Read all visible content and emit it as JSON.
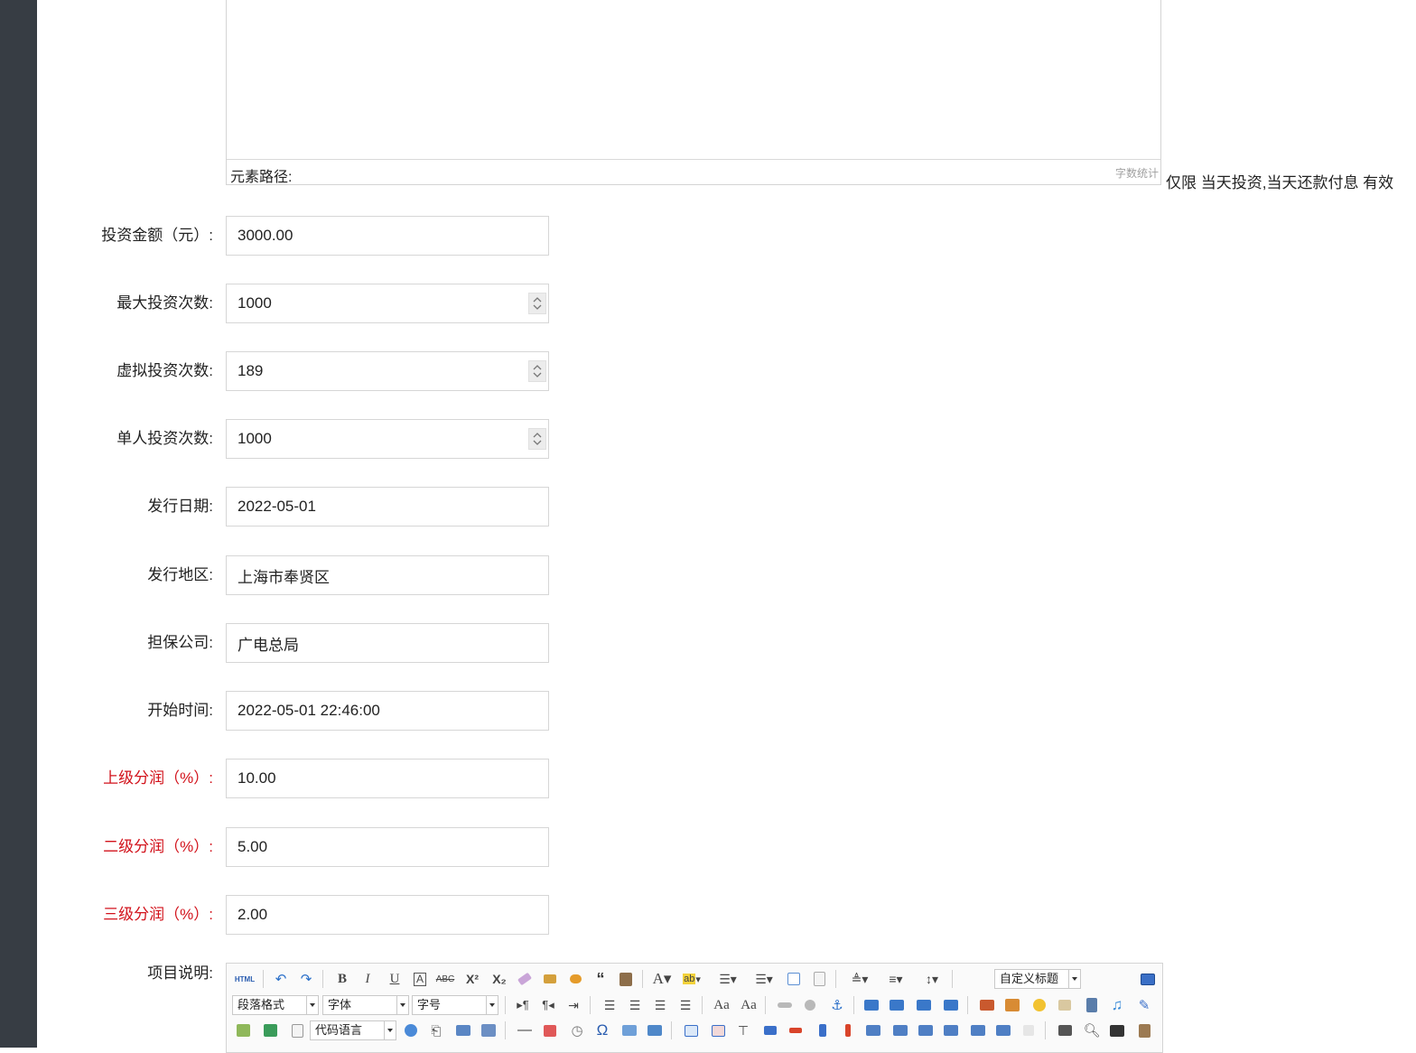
{
  "editor_top": {
    "element_path_label": "元素路径:",
    "word_count_label": "字数统计"
  },
  "note_text": "仅限 当天投资,当天还款付息 有效",
  "fields": [
    {
      "label": "投资金额（元）:",
      "value": "3000.00",
      "type": "text",
      "required": false
    },
    {
      "label": "最大投资次数:",
      "value": "1000",
      "type": "number",
      "required": false
    },
    {
      "label": "虚拟投资次数:",
      "value": "189",
      "type": "number",
      "required": false
    },
    {
      "label": "单人投资次数:",
      "value": "1000",
      "type": "number",
      "required": false
    },
    {
      "label": "发行日期:",
      "value": "2022-05-01",
      "type": "text",
      "required": false
    },
    {
      "label": "发行地区:",
      "value": "上海市奉贤区",
      "type": "text",
      "required": false
    },
    {
      "label": "担保公司:",
      "value": "广电总局",
      "type": "text",
      "required": false
    },
    {
      "label": "开始时间:",
      "value": "2022-05-01 22:46:00",
      "type": "text",
      "required": false
    },
    {
      "label": "上级分润（%）:",
      "value": "10.00",
      "type": "text",
      "required": true
    },
    {
      "label": "二级分润（%）:",
      "value": "5.00",
      "type": "text",
      "required": true
    },
    {
      "label": "三级分润（%）:",
      "value": "2.00",
      "type": "text",
      "required": true
    }
  ],
  "project_description_label": "项目说明:",
  "editor_bottom": {
    "html_label": "HTML",
    "custom_heading": "自定义标题",
    "paragraph_format": "段落格式",
    "font_family": "字体",
    "font_size": "字号",
    "code_language": "代码语言"
  },
  "colors": {
    "sidebar": "#373d44",
    "required_label": "#d2121b",
    "border": "#d6d6d6"
  }
}
